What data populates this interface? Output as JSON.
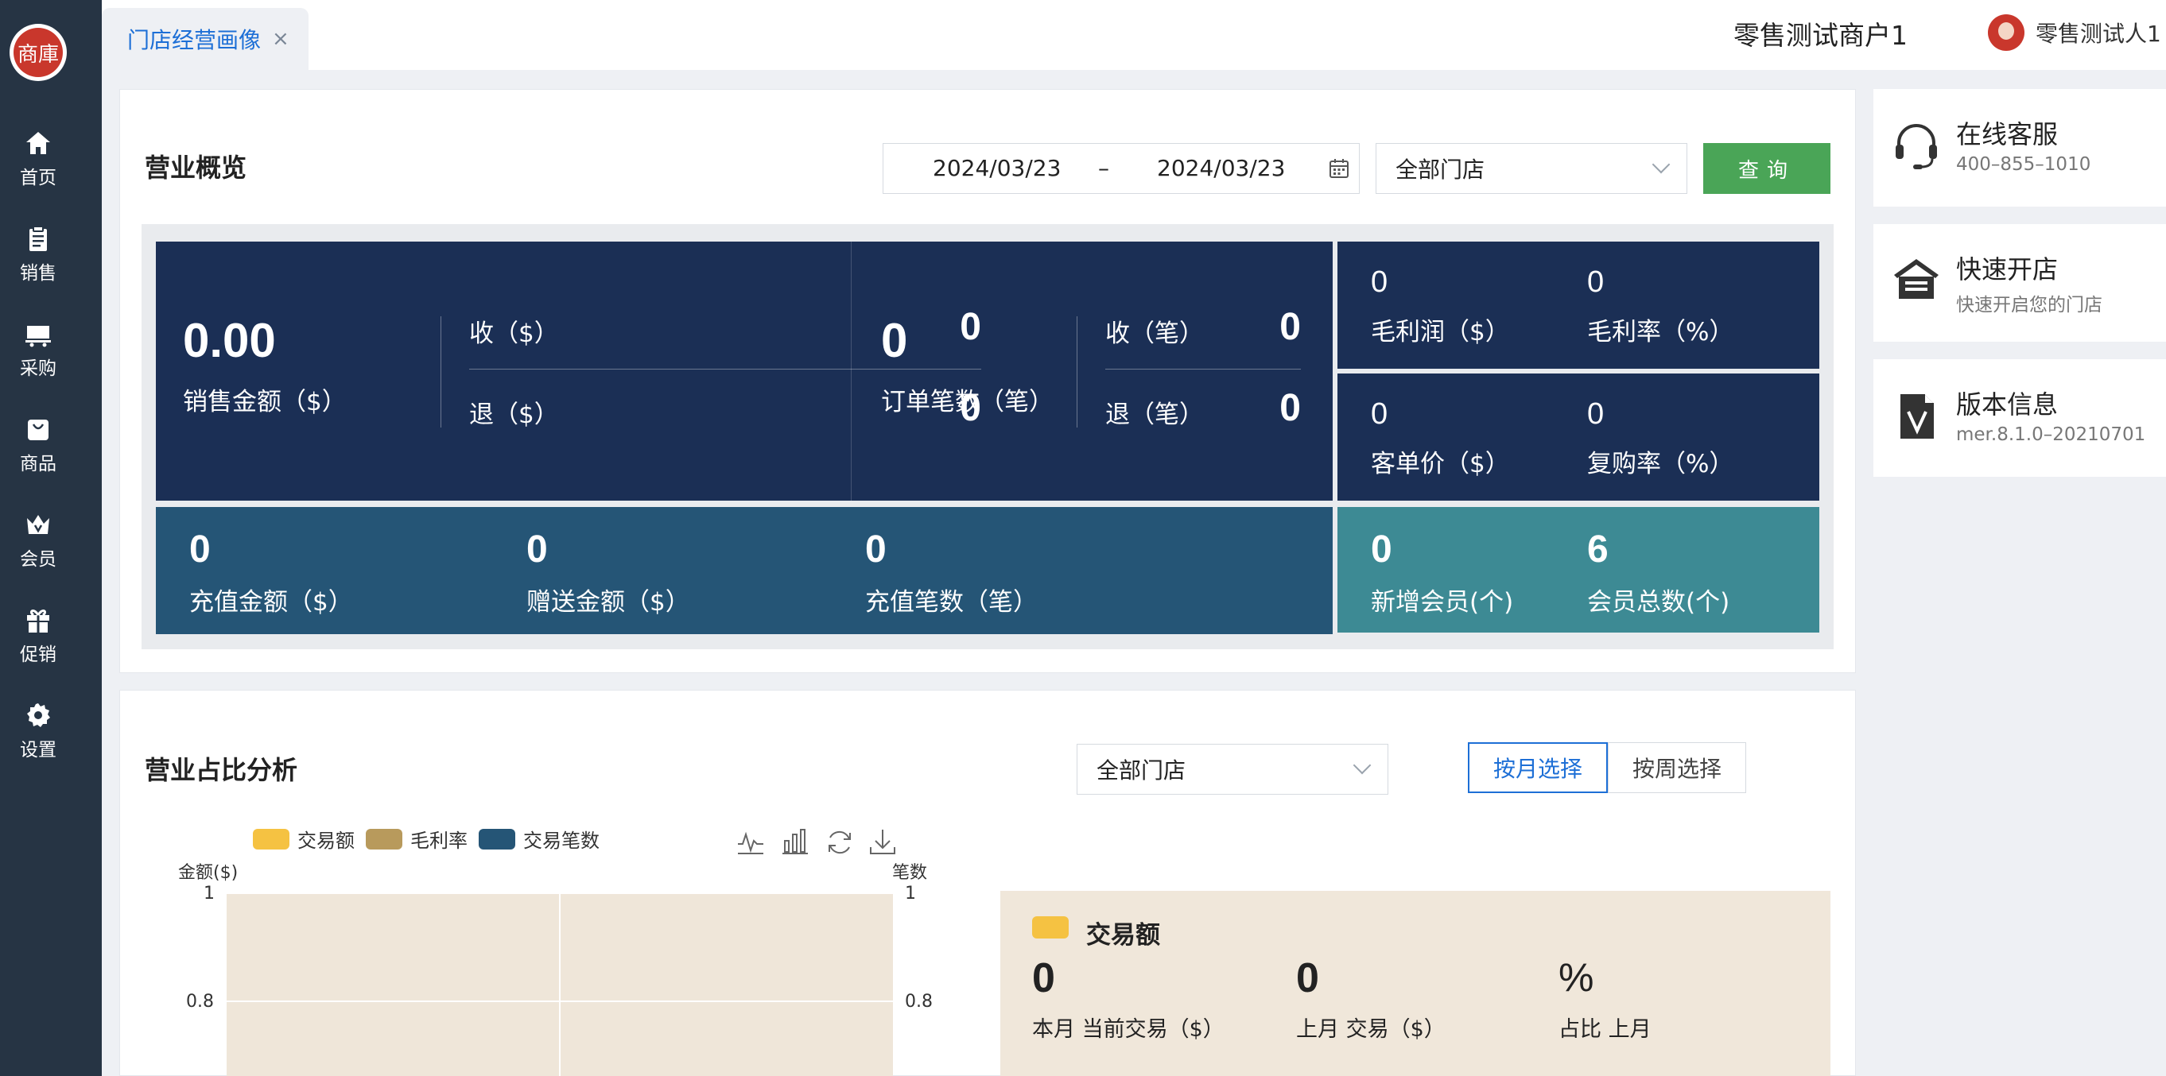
{
  "sidebar": {
    "logo_text": "商庫",
    "items": [
      {
        "label": "首页",
        "icon": "home-icon"
      },
      {
        "label": "销售",
        "icon": "clipboard-icon"
      },
      {
        "label": "采购",
        "icon": "cart-icon"
      },
      {
        "label": "商品",
        "icon": "bag-icon"
      },
      {
        "label": "会员",
        "icon": "crown-icon"
      },
      {
        "label": "促销",
        "icon": "gift-icon"
      },
      {
        "label": "设置",
        "icon": "gear-icon"
      }
    ]
  },
  "header": {
    "tab_label": "门店经营画像",
    "tab_close": "×",
    "merchant": "零售测试商户1",
    "user": "零售测试人1"
  },
  "overview": {
    "title": "营业概览",
    "date_start": "2024/03/23",
    "date_sep": "–",
    "date_end": "2024/03/23",
    "store_select": "全部门店",
    "query_label": "查询",
    "sales_amount": "0.00",
    "sales_amount_label": "销售金额（$）",
    "income_label": "收（$）",
    "income_value": "0",
    "refund_label": "退（$）",
    "refund_value": "0",
    "orders": "0",
    "orders_label": "订单笔数（笔）",
    "income_count_label": "收（笔）",
    "income_count_value": "0",
    "refund_count_label": "退（笔）",
    "refund_count_value": "0",
    "gross_profit": "0",
    "gross_profit_label": "毛利润（$）",
    "gross_margin": "0",
    "gross_margin_label": "毛利率（%）",
    "avg_ticket": "0",
    "avg_ticket_label": "客单价（$）",
    "repurchase": "0",
    "repurchase_label": "复购率（%）",
    "recharge_amount": "0",
    "recharge_amount_label": "充值金额（$）",
    "gift_amount": "0",
    "gift_amount_label": "赠送金额（$）",
    "recharge_count": "0",
    "recharge_count_label": "充值笔数（笔）",
    "new_members": "0",
    "new_members_label": "新增会员(个)",
    "total_members": "6",
    "total_members_label": "会员总数(个)"
  },
  "side": {
    "service_title": "在线客服",
    "service_phone": "400–855–1010",
    "open_title": "快速开店",
    "open_sub": "快速开启您的门店",
    "version_title": "版本信息",
    "version_sub": "mer.8.1.0–20210701"
  },
  "analysis": {
    "title": "营业占比分析",
    "store_select": "全部门店",
    "by_month": "按月选择",
    "by_week": "按周选择",
    "legend": [
      {
        "label": "交易额",
        "color": "#f5c242"
      },
      {
        "label": "毛利率",
        "color": "#b89a5c"
      },
      {
        "label": "交易笔数",
        "color": "#255576"
      }
    ],
    "left_axis_title": "金额($)",
    "right_axis_title": "笔数",
    "ticks": [
      "1",
      "0.8"
    ],
    "panel_title": "交易额",
    "cur_value": "0",
    "cur_label": "本月 当前交易（$）",
    "last_value": "0",
    "last_label": "上月 交易（$）",
    "ratio_value": "%",
    "ratio_label": "占比 上月"
  },
  "colors": {
    "sidebar": "#263444",
    "navy": "#1b2f55",
    "steel": "#255576",
    "teal": "#3d8a94",
    "accent": "#1d6fd6",
    "query": "#4aa557"
  }
}
